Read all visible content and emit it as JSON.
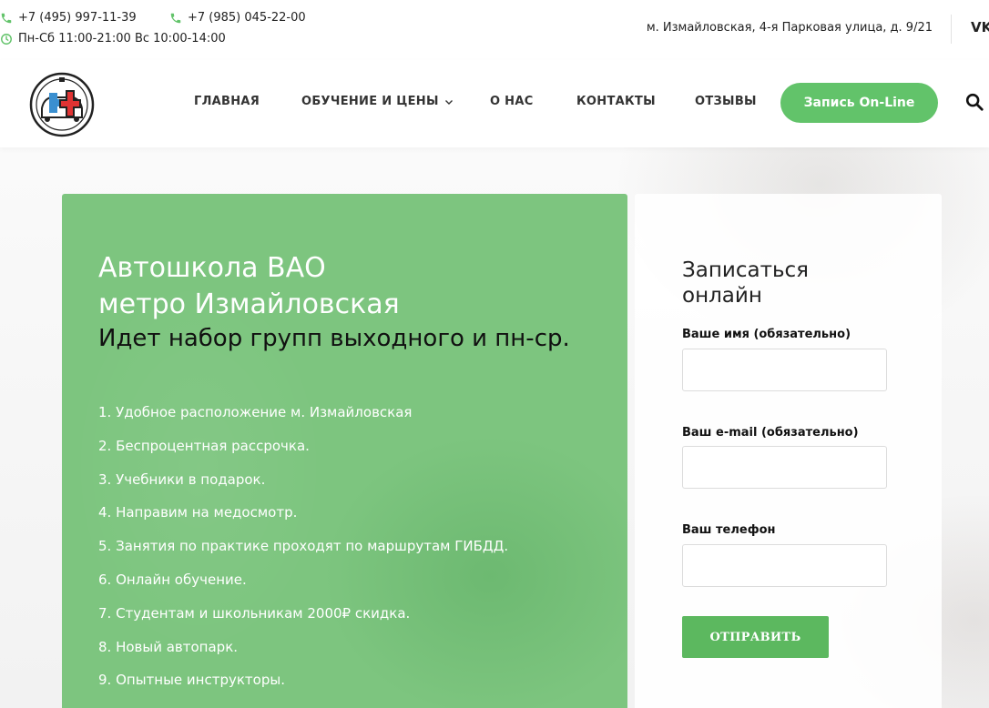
{
  "topbar": {
    "phone1": "+7 (495) 997-11-39",
    "phone2": "+7 (985) 045-22-00",
    "hours": "Пн-Сб 11:00-21:00 Вс 10:00-14:00",
    "address": "м. Измайловская, 4-я Парковая улица, д. 9/21",
    "vk_label": "VK",
    "icons": {
      "phone": "phone-icon",
      "clock": "clock-icon",
      "social": "vk-icon"
    },
    "accent_color": "#62c36a"
  },
  "nav": {
    "items": [
      {
        "label": "ГЛАВНАЯ"
      },
      {
        "label": "ОБУЧЕНИЕ И ЦЕНЫ",
        "has_dropdown": true
      },
      {
        "label": "О НАС"
      },
      {
        "label": "КОНТАКТЫ"
      },
      {
        "label": "ОТЗЫВЫ"
      }
    ],
    "signup_label": "Запись On-Line",
    "search_icon": "search-icon"
  },
  "hero": {
    "title": "Автошкола ВАО\nметро Измайловская",
    "subtitle": "Идет набор групп выходного и пн-ср.",
    "features": [
      "1. Удобное расположение м. Измайловская",
      "2. Беспроцентная рассрочка.",
      "3. Учебники в подарок.",
      "4. Направим на медосмотр.",
      "5. Занятия по практике проходят по маршрутам ГИБДД.",
      "6. Онлайн обучение.",
      "7. Студентам и школьникам 2000₽ скидка.",
      "8. Новый автопарк.",
      "9. Опытные инструкторы."
    ],
    "card_color": "#7dc57f"
  },
  "form": {
    "title": "Записаться онлайн",
    "name_label": "Ваше имя (обязательно)",
    "name_value": "",
    "email_label": "Ваш e-mail (обязательно)",
    "email_value": "",
    "phone_label": "Ваш телефон",
    "phone_value": "",
    "submit_label": "ОТПРАВИТЬ",
    "button_color": "#5cb85f"
  }
}
